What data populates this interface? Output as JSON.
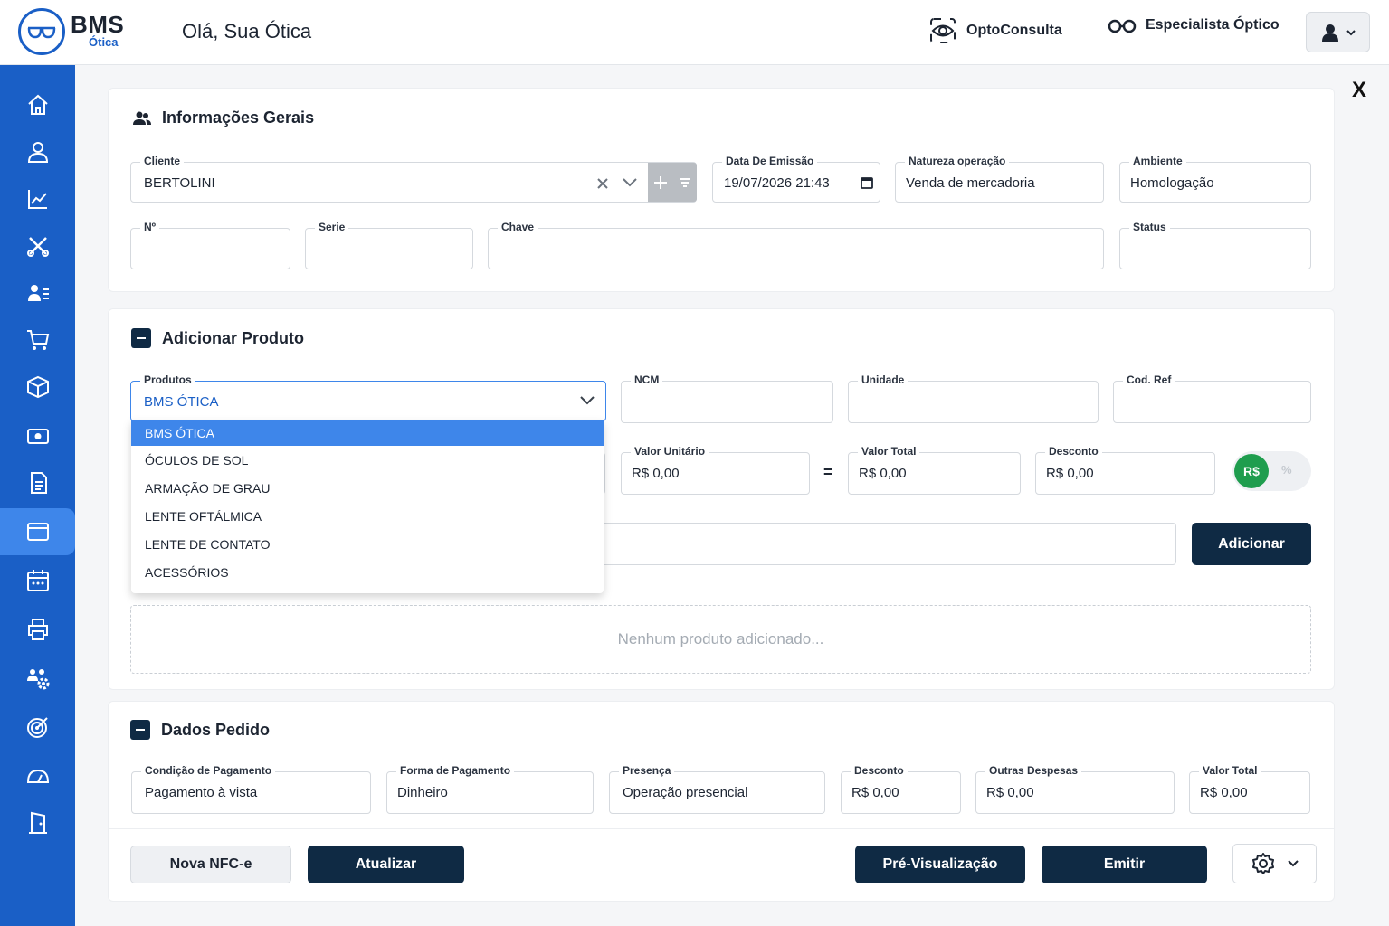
{
  "header": {
    "logo_title": "BMS",
    "logo_subtitle": "Ótica",
    "greeting": "Olá, Sua Ótica",
    "links": [
      "OptoConsulta",
      "Especialista Óptico"
    ]
  },
  "info_gerais": {
    "title": "Informações Gerais",
    "cliente": {
      "label": "Cliente",
      "value": "BERTOLINI"
    },
    "data_emissao": {
      "label": "Data De Emissão",
      "value": "19/07/2026 21:43"
    },
    "natureza": {
      "label": "Natureza operação",
      "value": "Venda de mercadoria"
    },
    "ambiente": {
      "label": "Ambiente",
      "value": "Homologação"
    },
    "numero": {
      "label": "Nº",
      "value": ""
    },
    "serie": {
      "label": "Serie",
      "value": ""
    },
    "chave": {
      "label": "Chave",
      "value": ""
    },
    "status": {
      "label": "Status",
      "value": ""
    }
  },
  "produto": {
    "title": "Adicionar Produto",
    "produtos": {
      "label": "Produtos",
      "value": "BMS ÓTICA"
    },
    "options": [
      "BMS ÓTICA",
      "ÓCULOS DE SOL",
      "ARMAÇÃO DE GRAU",
      "LENTE OFTÁLMICA",
      "LENTE DE CONTATO",
      "ACESSÓRIOS"
    ],
    "ncm": {
      "label": "NCM",
      "value": ""
    },
    "unidade": {
      "label": "Unidade",
      "value": ""
    },
    "cod_ref": {
      "label": "Cod. Ref",
      "value": ""
    },
    "valor_unitario": {
      "label": "Valor Unitário",
      "value": "R$ 0,00"
    },
    "equals": "=",
    "valor_total": {
      "label": "Valor Total",
      "value": "R$ 0,00"
    },
    "desconto": {
      "label": "Desconto",
      "value": "R$ 0,00"
    },
    "toggle_on": "R$",
    "toggle_off": "%",
    "add_button": "Adicionar",
    "empty_text": "Nenhum produto adicionado..."
  },
  "pedido": {
    "title": "Dados Pedido",
    "condicao": {
      "label": "Condição de Pagamento",
      "value": "Pagamento à vista"
    },
    "forma": {
      "label": "Forma de Pagamento",
      "value": "Dinheiro"
    },
    "presenca": {
      "label": "Presença",
      "value": "Operação presencial"
    },
    "desconto": {
      "label": "Desconto",
      "value": "R$ 0,00"
    },
    "outras": {
      "label": "Outras Despesas",
      "value": "R$ 0,00"
    },
    "valor_total": {
      "label": "Valor Total",
      "value": "R$ 0,00"
    }
  },
  "footer": {
    "nova": "Nova NFC-e",
    "atualizar": "Atualizar",
    "preview": "Pré-Visualização",
    "emitir": "Emitir"
  },
  "close_label": "X",
  "colors": {
    "primary": "#1a5fc6",
    "dark": "#0f2a44",
    "green": "#1f9d4e"
  }
}
